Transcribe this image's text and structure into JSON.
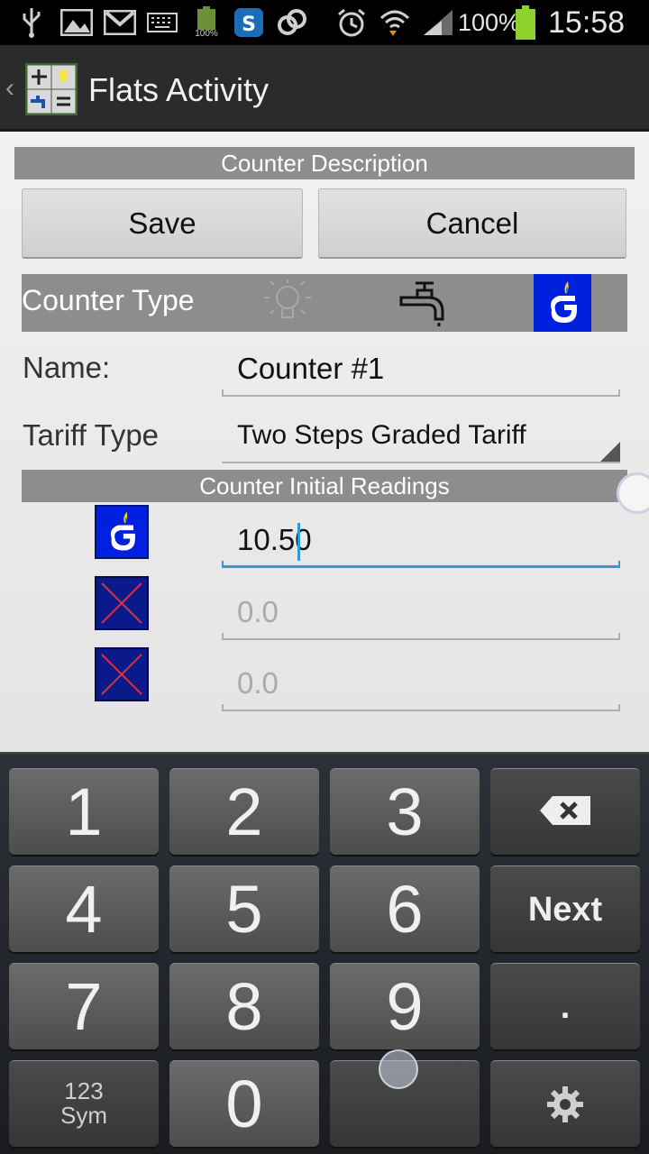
{
  "status_bar": {
    "battery_percent_label": "100%",
    "battery_icon_small_label": "100%",
    "time": "15:58",
    "icons": [
      "usb-icon",
      "image-icon",
      "gmail-icon",
      "keyboard-icon",
      "battery-icon",
      "skype-icon",
      "sync-icon",
      "alarm-icon",
      "wifi-icon",
      "signal-icon",
      "battery-full-icon"
    ]
  },
  "action_bar": {
    "title": "Flats Activity",
    "icons": [
      "back-icon",
      "app-logo-icon"
    ]
  },
  "form": {
    "description_header": "Counter Description",
    "save_label": "Save",
    "cancel_label": "Cancel",
    "counter_type_label": "Counter Type",
    "counter_type_icons": [
      "bulb-icon",
      "water-tap-icon",
      "gas-icon"
    ],
    "selected_counter_type": "gas-icon",
    "name_label": "Name:",
    "name_value": "Counter #1",
    "tariff_label": "Tariff Type",
    "tariff_value": "Two Steps Graded Tariff",
    "readings_header": "Counter Initial Readings",
    "readings": [
      {
        "icon": "gas-icon",
        "value": "10.50",
        "focused": true
      },
      {
        "icon": "disabled-x-icon",
        "value": "0.0",
        "hint": true
      },
      {
        "icon": "disabled-x-icon",
        "value": "0.0",
        "hint": true
      }
    ]
  },
  "keyboard": {
    "row1": [
      "1",
      "2",
      "3"
    ],
    "backspace_icon": "backspace-icon",
    "row2": [
      "4",
      "5",
      "6"
    ],
    "next_label": "Next",
    "row3": [
      "7",
      "8",
      "9"
    ],
    "dot_label": ".",
    "sym_top": "123",
    "sym_bottom": "Sym",
    "zero": "0",
    "settings_icon": "gear-icon"
  },
  "colors": {
    "header_gray": "#8d8d8d",
    "focus_blue": "#2a9ad8",
    "gas_blue": "#0020e0",
    "disabled_x_red": "#e0303a"
  }
}
